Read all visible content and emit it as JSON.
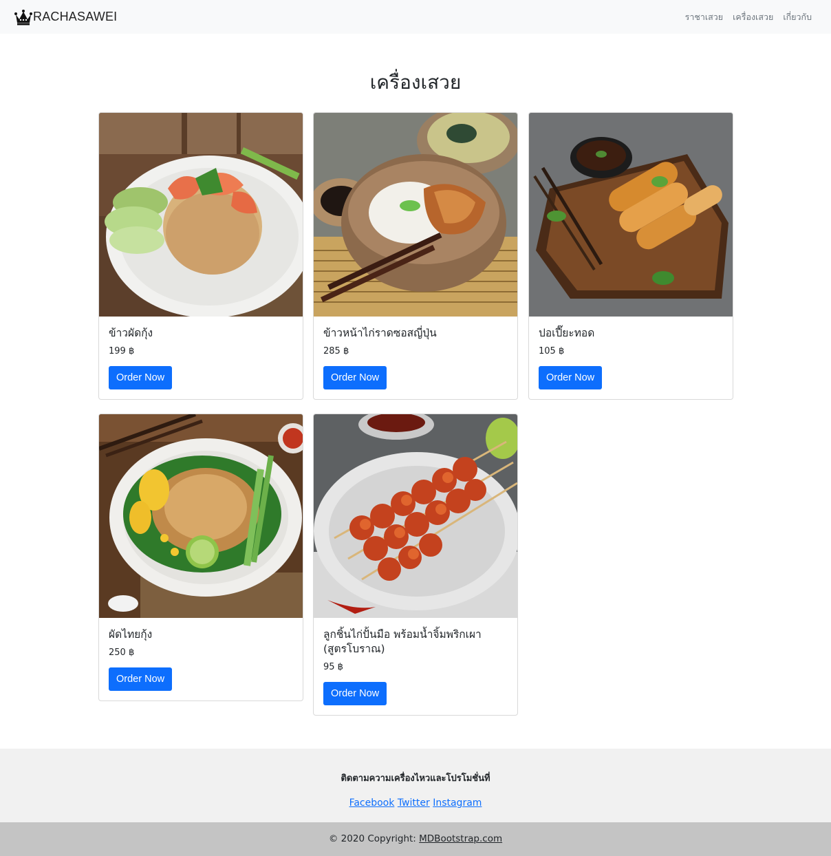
{
  "navbar": {
    "brand": "RACHASAWEI",
    "brand_icon": "crown-icon",
    "links": [
      "ราชาเสวย",
      "เครื่องเสวย",
      "เกี่ยวกับ"
    ]
  },
  "page_title": "เครื่องเสวย",
  "currency_symbol": "฿",
  "cards": [
    {
      "title": "ข้าวผัดกุ้ง",
      "price": "199 ฿",
      "button": "Order Now",
      "image": "shrimp-fried-rice-photo"
    },
    {
      "title": "ข้าวหน้าไก่ราดซอสญี่ปุ่น",
      "price": "285 ฿",
      "button": "Order Now",
      "image": "chicken-rice-bowl-photo"
    },
    {
      "title": "ปอเปี๊ยะทอด",
      "price": "105 ฿",
      "button": "Order Now",
      "image": "spring-rolls-photo"
    },
    {
      "title": "ผัดไทยกุ้ง",
      "price": "250 ฿",
      "button": "Order Now",
      "image": "pad-thai-photo"
    },
    {
      "title": "ลูกชิ้นไก่ปั้นมือ พร้อมน้ำจิ้มพริกเผา (สูตรโบราณ)",
      "price": "95 ฿",
      "button": "Order Now",
      "image": "chicken-meatball-skewers-photo"
    }
  ],
  "footer": {
    "follow_text": "ติดตามความเครื่องไหวและโปรโมชั่นที่",
    "social": [
      "Facebook",
      "Twitter",
      "Instagram"
    ]
  },
  "copyright": {
    "prefix": "© 2020 Copyright: ",
    "link": "MDBootstrap.com"
  },
  "colors": {
    "primary": "#0d6efd",
    "navbar_bg": "#f8f9fa",
    "footer_bg": "#f1f1f1",
    "copyright_bg": "#c4c4c4"
  }
}
